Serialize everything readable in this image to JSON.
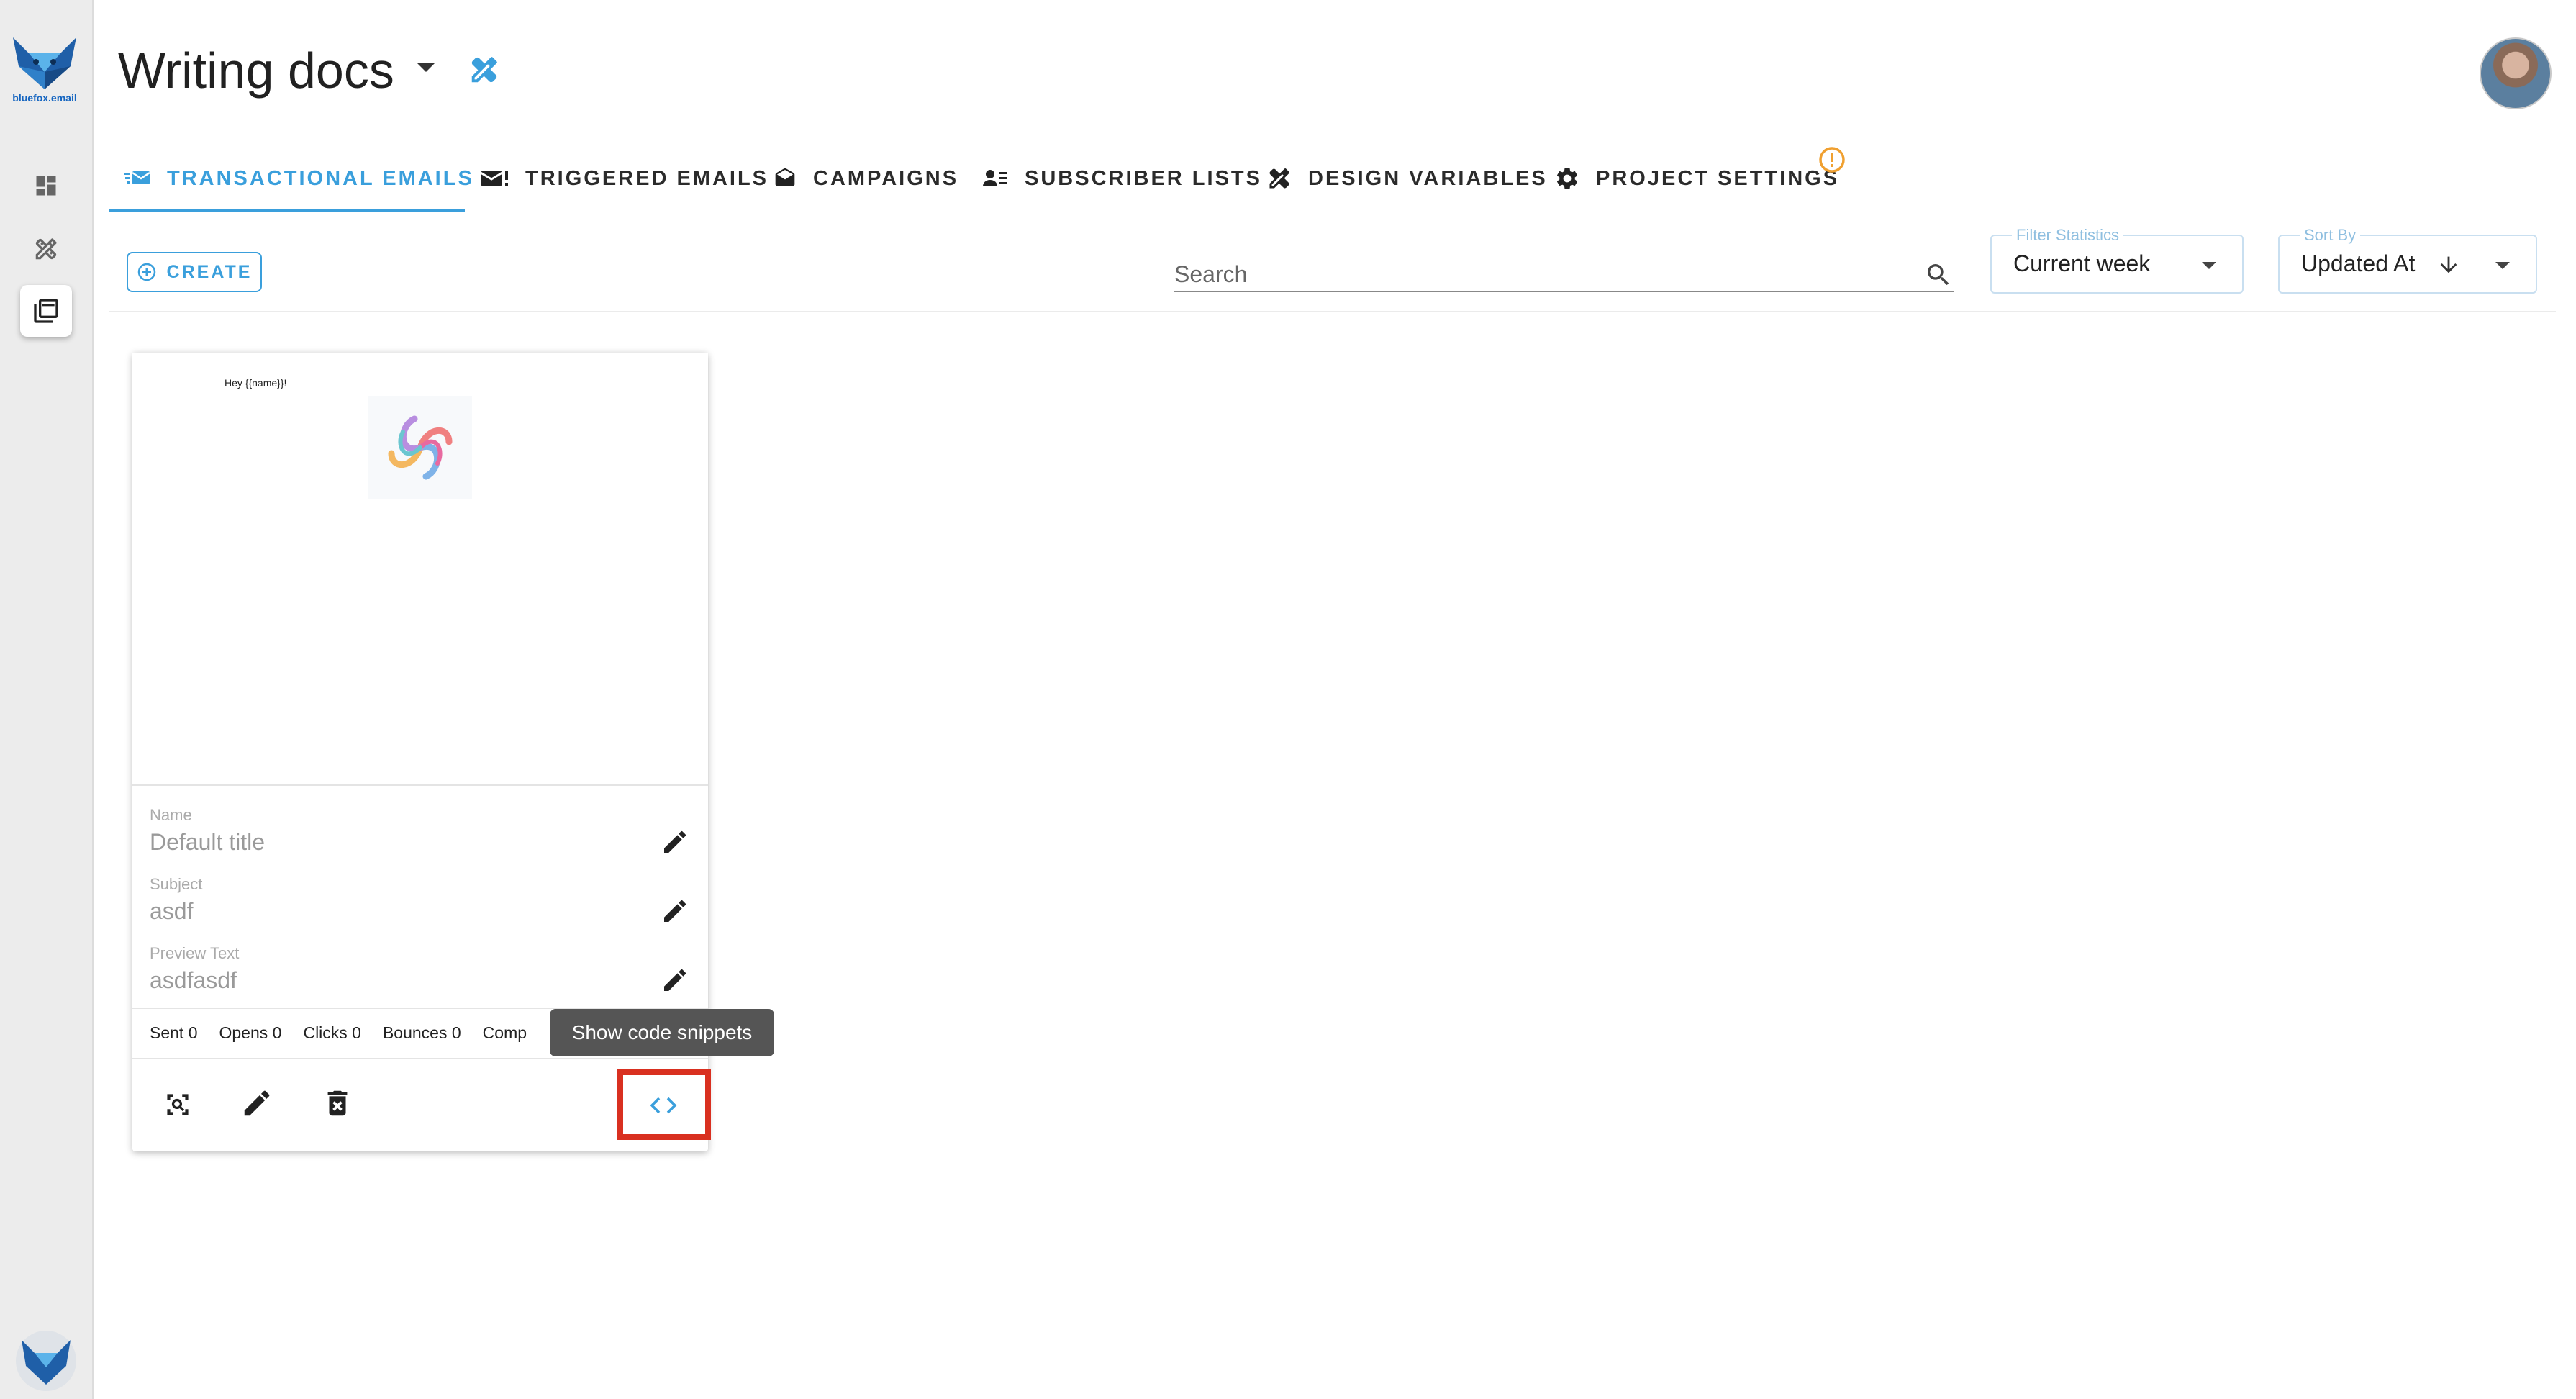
{
  "brand": {
    "logo_text": "bluefox.email"
  },
  "header": {
    "project_title": "Writing docs"
  },
  "tabs": [
    {
      "label": "TRANSACTIONAL EMAILS",
      "icon": "transactional-email-icon",
      "active": true
    },
    {
      "label": "TRIGGERED EMAILS",
      "icon": "triggered-email-icon",
      "active": false
    },
    {
      "label": "CAMPAIGNS",
      "icon": "campaigns-icon",
      "active": false
    },
    {
      "label": "SUBSCRIBER LISTS",
      "icon": "subscriber-lists-icon",
      "active": false
    },
    {
      "label": "DESIGN VARIABLES",
      "icon": "design-variables-icon",
      "active": false
    },
    {
      "label": "PROJECT SETTINGS",
      "icon": "gear-icon",
      "active": false
    }
  ],
  "toolbar": {
    "create_label": "CREATE",
    "search_placeholder": "Search",
    "filter": {
      "label": "Filter Statistics",
      "value": "Current week"
    },
    "sort": {
      "label": "Sort By",
      "value": "Updated At"
    }
  },
  "card": {
    "preview_greeting": "Hey {{name}}!",
    "fields": [
      {
        "label": "Name",
        "value": "Default title"
      },
      {
        "label": "Subject",
        "value": "asdf"
      },
      {
        "label": "Preview Text",
        "value": "asdfasdf"
      }
    ],
    "stats": [
      "Sent 0",
      "Opens 0",
      "Clicks 0",
      "Bounces 0",
      "Comp"
    ]
  },
  "tooltip": {
    "text": "Show code snippets"
  },
  "colors": {
    "accent": "#3a9fdc",
    "warning": "#f0a030",
    "highlight": "#d93020"
  }
}
